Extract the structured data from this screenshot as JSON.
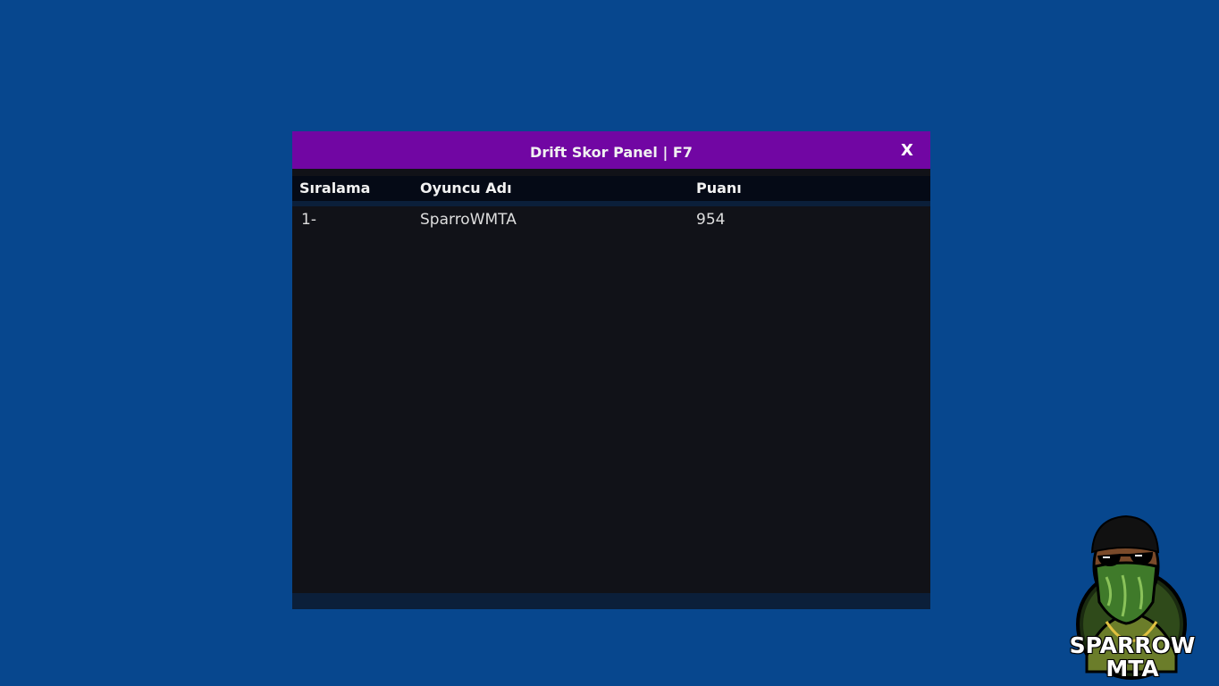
{
  "panel": {
    "title": "Drift Skor Panel | F7",
    "close_label": "X",
    "colors": {
      "titlebar": "#7106a3",
      "background": "#111218",
      "desktop": "#07478e"
    },
    "columns": {
      "rank": "Sıralama",
      "player": "Oyuncu Adı",
      "score": "Puanı"
    },
    "rows": [
      {
        "rank": "1-",
        "player": "SparroWMTA",
        "score": "954"
      }
    ]
  },
  "logo": {
    "line1": "SPARROW",
    "line2": "MTA",
    "icon": "masked-character-logo"
  }
}
